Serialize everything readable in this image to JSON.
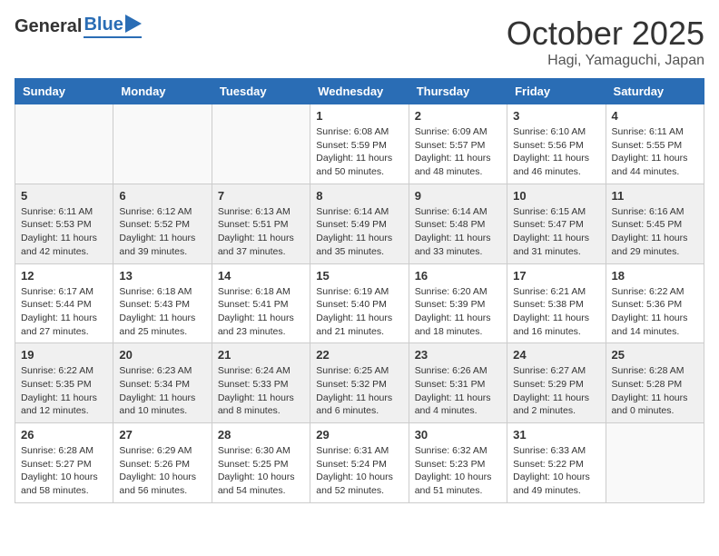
{
  "header": {
    "logo_general": "General",
    "logo_blue": "Blue",
    "month_title": "October 2025",
    "location": "Hagi, Yamaguchi, Japan"
  },
  "calendar": {
    "days_of_week": [
      "Sunday",
      "Monday",
      "Tuesday",
      "Wednesday",
      "Thursday",
      "Friday",
      "Saturday"
    ],
    "weeks": [
      [
        {
          "day": "",
          "info": ""
        },
        {
          "day": "",
          "info": ""
        },
        {
          "day": "",
          "info": ""
        },
        {
          "day": "1",
          "info": "Sunrise: 6:08 AM\nSunset: 5:59 PM\nDaylight: 11 hours\nand 50 minutes."
        },
        {
          "day": "2",
          "info": "Sunrise: 6:09 AM\nSunset: 5:57 PM\nDaylight: 11 hours\nand 48 minutes."
        },
        {
          "day": "3",
          "info": "Sunrise: 6:10 AM\nSunset: 5:56 PM\nDaylight: 11 hours\nand 46 minutes."
        },
        {
          "day": "4",
          "info": "Sunrise: 6:11 AM\nSunset: 5:55 PM\nDaylight: 11 hours\nand 44 minutes."
        }
      ],
      [
        {
          "day": "5",
          "info": "Sunrise: 6:11 AM\nSunset: 5:53 PM\nDaylight: 11 hours\nand 42 minutes."
        },
        {
          "day": "6",
          "info": "Sunrise: 6:12 AM\nSunset: 5:52 PM\nDaylight: 11 hours\nand 39 minutes."
        },
        {
          "day": "7",
          "info": "Sunrise: 6:13 AM\nSunset: 5:51 PM\nDaylight: 11 hours\nand 37 minutes."
        },
        {
          "day": "8",
          "info": "Sunrise: 6:14 AM\nSunset: 5:49 PM\nDaylight: 11 hours\nand 35 minutes."
        },
        {
          "day": "9",
          "info": "Sunrise: 6:14 AM\nSunset: 5:48 PM\nDaylight: 11 hours\nand 33 minutes."
        },
        {
          "day": "10",
          "info": "Sunrise: 6:15 AM\nSunset: 5:47 PM\nDaylight: 11 hours\nand 31 minutes."
        },
        {
          "day": "11",
          "info": "Sunrise: 6:16 AM\nSunset: 5:45 PM\nDaylight: 11 hours\nand 29 minutes."
        }
      ],
      [
        {
          "day": "12",
          "info": "Sunrise: 6:17 AM\nSunset: 5:44 PM\nDaylight: 11 hours\nand 27 minutes."
        },
        {
          "day": "13",
          "info": "Sunrise: 6:18 AM\nSunset: 5:43 PM\nDaylight: 11 hours\nand 25 minutes."
        },
        {
          "day": "14",
          "info": "Sunrise: 6:18 AM\nSunset: 5:41 PM\nDaylight: 11 hours\nand 23 minutes."
        },
        {
          "day": "15",
          "info": "Sunrise: 6:19 AM\nSunset: 5:40 PM\nDaylight: 11 hours\nand 21 minutes."
        },
        {
          "day": "16",
          "info": "Sunrise: 6:20 AM\nSunset: 5:39 PM\nDaylight: 11 hours\nand 18 minutes."
        },
        {
          "day": "17",
          "info": "Sunrise: 6:21 AM\nSunset: 5:38 PM\nDaylight: 11 hours\nand 16 minutes."
        },
        {
          "day": "18",
          "info": "Sunrise: 6:22 AM\nSunset: 5:36 PM\nDaylight: 11 hours\nand 14 minutes."
        }
      ],
      [
        {
          "day": "19",
          "info": "Sunrise: 6:22 AM\nSunset: 5:35 PM\nDaylight: 11 hours\nand 12 minutes."
        },
        {
          "day": "20",
          "info": "Sunrise: 6:23 AM\nSunset: 5:34 PM\nDaylight: 11 hours\nand 10 minutes."
        },
        {
          "day": "21",
          "info": "Sunrise: 6:24 AM\nSunset: 5:33 PM\nDaylight: 11 hours\nand 8 minutes."
        },
        {
          "day": "22",
          "info": "Sunrise: 6:25 AM\nSunset: 5:32 PM\nDaylight: 11 hours\nand 6 minutes."
        },
        {
          "day": "23",
          "info": "Sunrise: 6:26 AM\nSunset: 5:31 PM\nDaylight: 11 hours\nand 4 minutes."
        },
        {
          "day": "24",
          "info": "Sunrise: 6:27 AM\nSunset: 5:29 PM\nDaylight: 11 hours\nand 2 minutes."
        },
        {
          "day": "25",
          "info": "Sunrise: 6:28 AM\nSunset: 5:28 PM\nDaylight: 11 hours\nand 0 minutes."
        }
      ],
      [
        {
          "day": "26",
          "info": "Sunrise: 6:28 AM\nSunset: 5:27 PM\nDaylight: 10 hours\nand 58 minutes."
        },
        {
          "day": "27",
          "info": "Sunrise: 6:29 AM\nSunset: 5:26 PM\nDaylight: 10 hours\nand 56 minutes."
        },
        {
          "day": "28",
          "info": "Sunrise: 6:30 AM\nSunset: 5:25 PM\nDaylight: 10 hours\nand 54 minutes."
        },
        {
          "day": "29",
          "info": "Sunrise: 6:31 AM\nSunset: 5:24 PM\nDaylight: 10 hours\nand 52 minutes."
        },
        {
          "day": "30",
          "info": "Sunrise: 6:32 AM\nSunset: 5:23 PM\nDaylight: 10 hours\nand 51 minutes."
        },
        {
          "day": "31",
          "info": "Sunrise: 6:33 AM\nSunset: 5:22 PM\nDaylight: 10 hours\nand 49 minutes."
        },
        {
          "day": "",
          "info": ""
        }
      ]
    ]
  }
}
